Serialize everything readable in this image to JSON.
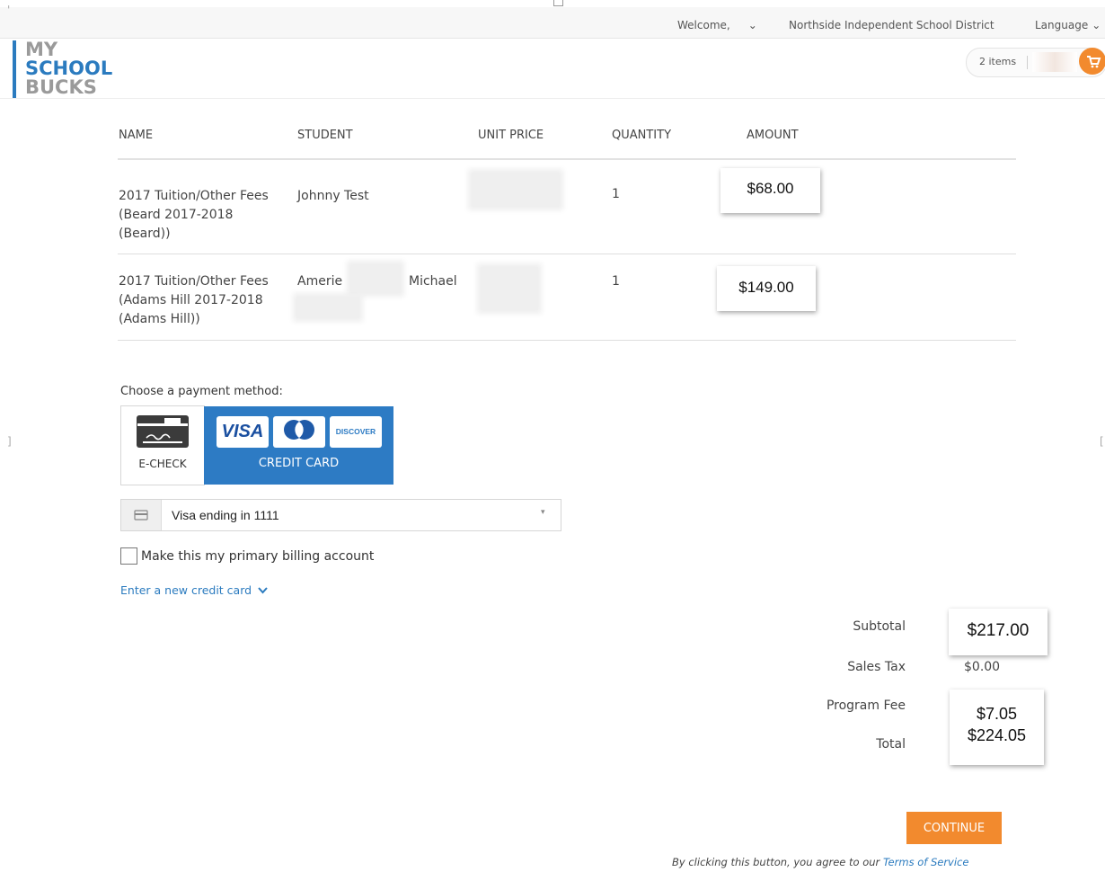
{
  "topnav": {
    "welcome": "Welcome,",
    "district": "Northside Independent School District",
    "language": "Language"
  },
  "logo": {
    "line1": "MY",
    "line2": "SCHOOL",
    "line3": "BUCKS",
    "colors": {
      "gray": "#9a9a9a",
      "blue": "#2b7bbf"
    }
  },
  "cart": {
    "count_label": "2 items"
  },
  "table": {
    "headers": [
      "NAME",
      "STUDENT",
      "UNIT PRICE",
      "QUANTITY",
      "AMOUNT"
    ],
    "rows": [
      {
        "name": [
          "2017 Tuition/Other Fees",
          "(Beard 2017-2018",
          "(Beard))"
        ],
        "student": "Johnny Test",
        "student_last": "",
        "quantity": "1",
        "amount": "$68.00"
      },
      {
        "name": [
          "2017 Tuition/Other Fees",
          "(Adams Hill 2017-2018",
          "(Adams Hill))"
        ],
        "student": "Amerie",
        "student_last": "Michael",
        "quantity": "1",
        "amount": "$149.00"
      }
    ]
  },
  "payment": {
    "label": "Choose a payment method:",
    "echeck_label": "E-CHECK",
    "credit_label": "CREDIT CARD",
    "visa": "VISA",
    "discover": "DISCOVER",
    "selected_account": "Visa ending in 1111",
    "primary_checkbox_label": "Make this my primary billing account",
    "new_card_link": "Enter a new credit card",
    "colors": {
      "selected": "#2d7bc4",
      "accent": "#f28a2e"
    }
  },
  "summary": {
    "subtotal_label": "Subtotal",
    "subtotal": "$217.00",
    "tax_label": "Sales Tax",
    "tax": "$0.00",
    "fee_label": "Program Fee",
    "fee": "$7.05",
    "total_label": "Total",
    "total": "$224.05"
  },
  "actions": {
    "continue": "CONTINUE",
    "legal_text": "By clicking this button, you agree to our",
    "terms_link": "Terms of Service"
  }
}
